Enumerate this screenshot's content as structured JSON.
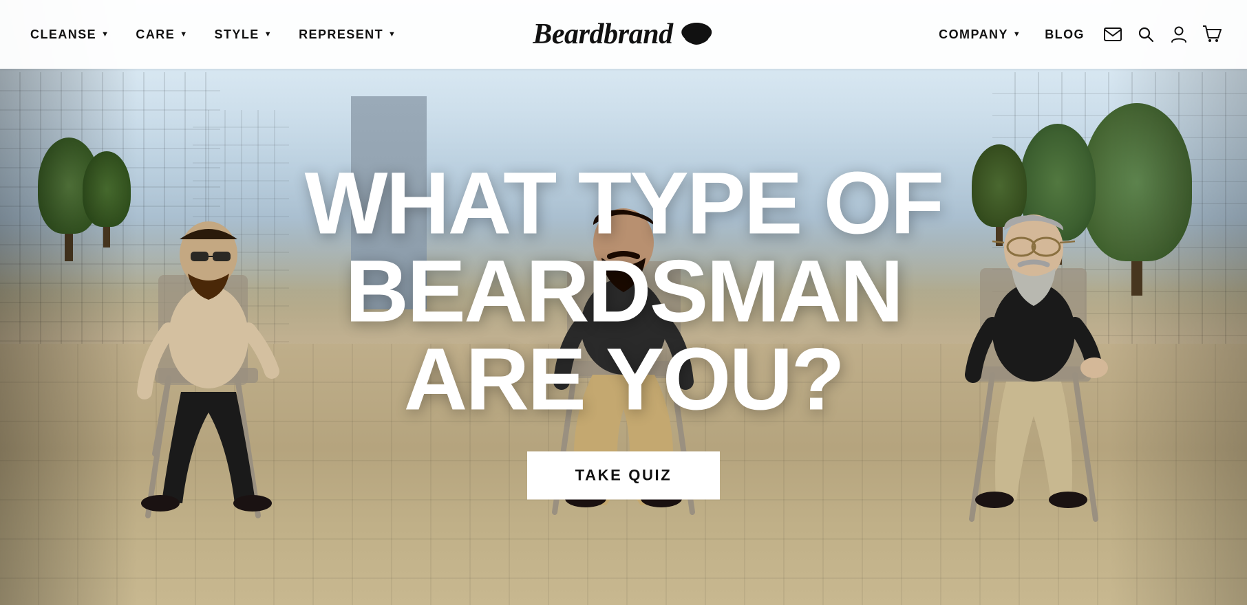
{
  "navbar": {
    "brand": "Beardbrand",
    "brand_icon": "🧔",
    "nav_left": [
      {
        "label": "CLEANSE",
        "has_dropdown": true
      },
      {
        "label": "CARE",
        "has_dropdown": true
      },
      {
        "label": "STYLE",
        "has_dropdown": true
      },
      {
        "label": "REPRESENT",
        "has_dropdown": true
      }
    ],
    "nav_right": [
      {
        "label": "COMPANY",
        "has_dropdown": true
      },
      {
        "label": "BLOG",
        "has_dropdown": false
      }
    ],
    "icons": [
      {
        "name": "email-icon",
        "symbol": "✉"
      },
      {
        "name": "search-icon",
        "symbol": "🔍"
      },
      {
        "name": "account-icon",
        "symbol": "👤"
      },
      {
        "name": "cart-icon",
        "symbol": "🛒"
      }
    ]
  },
  "hero": {
    "headline_line1": "WHAT TYPE OF BEARDSMAN",
    "headline_line2": "ARE YOU?",
    "cta_label": "TAKE QUIZ",
    "colors": {
      "headline": "#ffffff",
      "cta_bg": "#ffffff",
      "cta_text": "#111111"
    }
  }
}
